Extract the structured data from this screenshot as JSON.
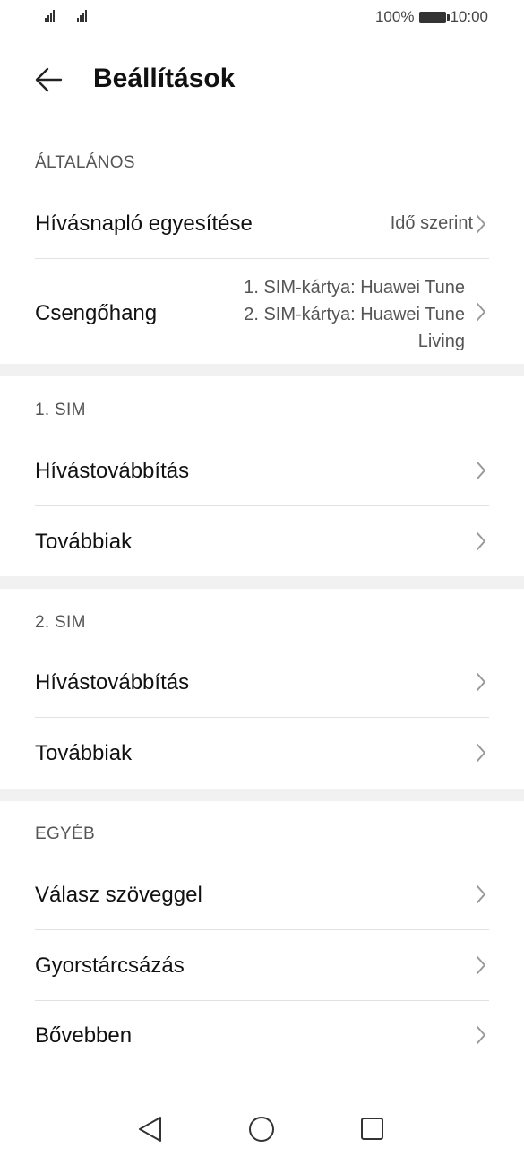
{
  "status_bar": {
    "battery_percent": "100%",
    "time": "10:00",
    "icons": [
      "signal-icon",
      "signal-icon",
      "battery-icon"
    ]
  },
  "header": {
    "title": "Beállítások",
    "back_icon": "arrow-left-icon"
  },
  "sections": {
    "general": {
      "label": "ÁLTALÁNOS",
      "call_log_merge": {
        "label": "Hívásnapló egyesítése",
        "value": "Idő szerint"
      },
      "ringtone": {
        "label": "Csengőhang",
        "value_line1": "1. SIM-kártya: Huawei Tune",
        "value_line2": "2. SIM-kártya: Huawei Tune",
        "value_line3": "Living"
      }
    },
    "sim1": {
      "label": "1. SIM",
      "call_forwarding": "Hívástovábbítás",
      "more": "Továbbiak"
    },
    "sim2": {
      "label": "2. SIM",
      "call_forwarding": "Hívástovábbítás",
      "more": "Továbbiak"
    },
    "other": {
      "label": "EGYÉB",
      "quick_responses": "Válasz szöveggel",
      "speed_dial": "Gyorstárcsázás",
      "more": "Bővebben"
    }
  },
  "nav_bar": {
    "icons": [
      "back-triangle-icon",
      "home-circle-icon",
      "recents-square-icon"
    ]
  }
}
